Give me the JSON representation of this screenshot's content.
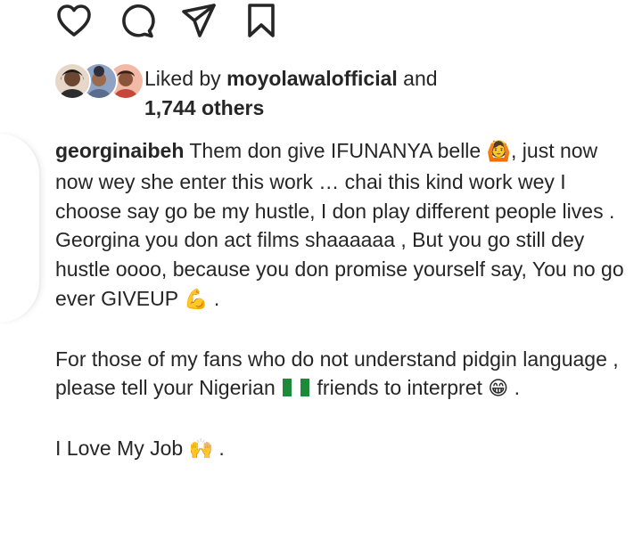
{
  "actions": {
    "like_icon": "heart-outline-icon",
    "comment_icon": "comment-bubble-icon",
    "share_icon": "paper-plane-icon",
    "save_icon": "bookmark-icon"
  },
  "likes": {
    "prefix": "Liked by ",
    "user": "moyolawalofficial",
    "and": " and",
    "others": "1,744 others"
  },
  "caption": {
    "username": "georginaibeh",
    "line1_text": " Them don give IFUNANYA belle ",
    "emoji_woman": "🙆",
    "line1_end": ", just now now wey she enter this work … chai this kind work wey I choose say go be my hustle, I don play different people lives .",
    "paragraph2": "Georgina you don act films shaaaaaa , But you go still dey hustle oooo, because you don promise yourself say, You no go ever GIVEUP ",
    "emoji_muscle": "💪",
    "paragraph2_end": " .",
    "paragraph3_start": "For those of my fans who do not understand pidgin language , please tell your Nigerian ",
    "flag_name": "nigeria-flag",
    "flag_colors": [
      "#1d8a3a",
      "#ffffff",
      "#1d8a3a"
    ],
    "paragraph3_mid": " friends to interpret ",
    "emoji_grin": "😁",
    "paragraph3_end": " .",
    "paragraph4_start": "I Love My Job ",
    "emoji_hands": "🙌",
    "paragraph4_end": " ."
  },
  "colors": {
    "text": "#262626",
    "icon": "#262626"
  }
}
